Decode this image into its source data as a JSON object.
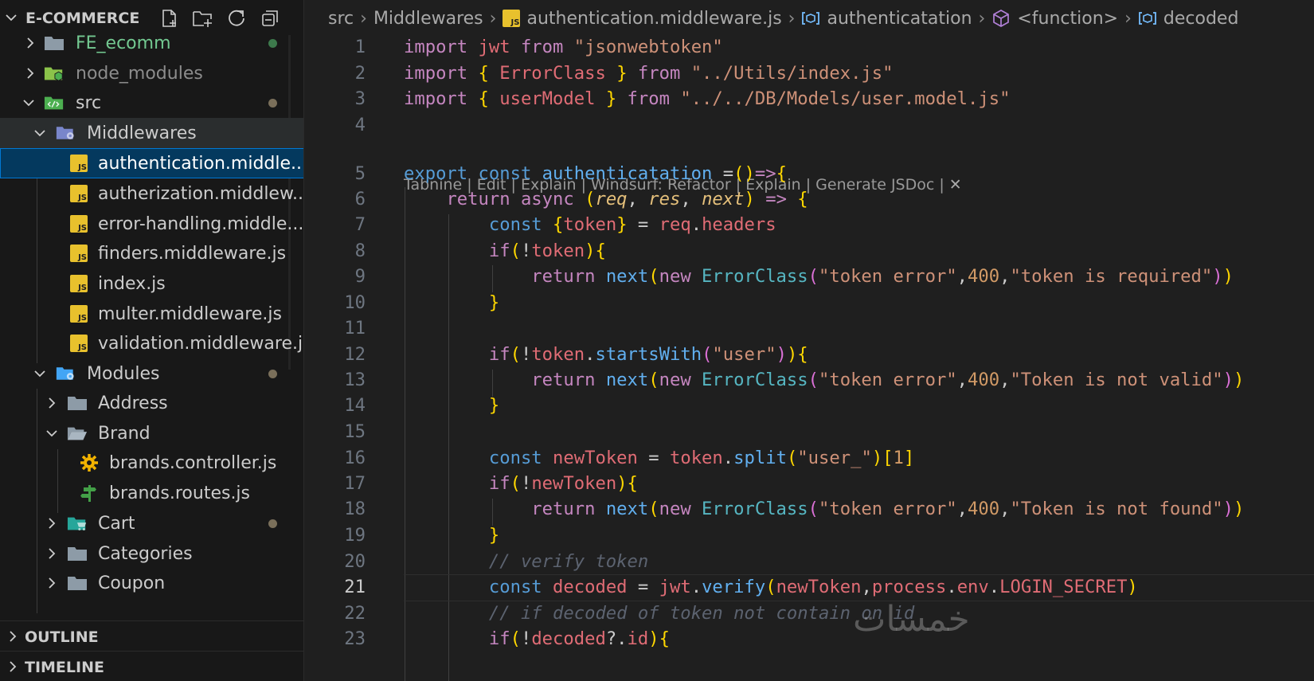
{
  "sidebar": {
    "title": "E-COMMERCE",
    "actions": [
      "new-file-icon",
      "new-folder-icon",
      "refresh-icon",
      "collapse-all-icon"
    ],
    "items": [
      {
        "label": "FE_ecomm",
        "icon": "folder-icon",
        "status": "green-dot"
      },
      {
        "label": "node_modules",
        "icon": "node-folder-icon"
      },
      {
        "label": "src",
        "icon": "src-folder-icon",
        "status": "modified-dot"
      },
      {
        "label": "Middlewares",
        "icon": "middleware-folder-icon"
      },
      {
        "label": "authentication.middle...",
        "icon": "js-file-icon"
      },
      {
        "label": "autherization.middlew...",
        "icon": "js-file-icon"
      },
      {
        "label": "error-handling.middle...",
        "icon": "js-file-icon"
      },
      {
        "label": "finders.middleware.js",
        "icon": "js-file-icon"
      },
      {
        "label": "index.js",
        "icon": "js-file-icon"
      },
      {
        "label": "multer.middleware.js",
        "icon": "js-file-icon"
      },
      {
        "label": "validation.middleware.js",
        "icon": "js-file-icon"
      },
      {
        "label": "Modules",
        "icon": "modules-folder-icon",
        "status": "modified-dot"
      },
      {
        "label": "Address",
        "icon": "folder-icon"
      },
      {
        "label": "Brand",
        "icon": "folder-open-icon"
      },
      {
        "label": "brands.controller.js",
        "icon": "gear-icon"
      },
      {
        "label": "brands.routes.js",
        "icon": "routes-icon"
      },
      {
        "label": "Cart",
        "icon": "cart-folder-icon",
        "status": "modified-dot"
      },
      {
        "label": "Categories",
        "icon": "folder-icon"
      },
      {
        "label": "Coupon",
        "icon": "folder-icon"
      }
    ],
    "sections": {
      "outline": "OUTLINE",
      "timeline": "TIMELINE"
    }
  },
  "breadcrumb": {
    "src": "src",
    "folder": "Middlewares",
    "file": "authentication.middleware.js",
    "symbol": "authenticatation",
    "function": "<function>",
    "variable": "decoded"
  },
  "editor": {
    "current_line": 21,
    "codelens": "Tabnine | Edit | Explain | Windsurf: Refactor | Explain | Generate JSDoc |",
    "line_numbers": [
      "1",
      "2",
      "3",
      "4",
      "5",
      "6",
      "7",
      "8",
      "9",
      "10",
      "11",
      "12",
      "13",
      "14",
      "15",
      "16",
      "17",
      "18",
      "19",
      "20",
      "21",
      "22",
      "23"
    ],
    "lines": [
      "import jwt from \"jsonwebtoken\"",
      "import { ErrorClass } from \"../Utils/index.js\"",
      "import { userModel } from \"../../DB/Models/user.model.js\"",
      "",
      "export const authenticatation =()=>{",
      "    return async (req, res, next) => {",
      "        const {token} = req.headers",
      "        if(!token){",
      "            return next(new ErrorClass(\"token error\",400,\"token is required\"))",
      "        }",
      "",
      "        if(!token.startsWith(\"user\")){",
      "            return next(new ErrorClass(\"token error\",400,\"Token is not valid\"))",
      "        }",
      "",
      "        const newToken = token.split(\"user_\")[1]",
      "        if(!newToken){",
      "            return next(new ErrorClass(\"token error\",400,\"Token is not found\"))",
      "        }",
      "        // verify token",
      "        const decoded = jwt.verify(newToken,process.env.LOGIN_SECRET)",
      "        // if decoded of token not contain on id",
      "        if(!decoded?.id){"
    ]
  },
  "watermark": "خمسات"
}
